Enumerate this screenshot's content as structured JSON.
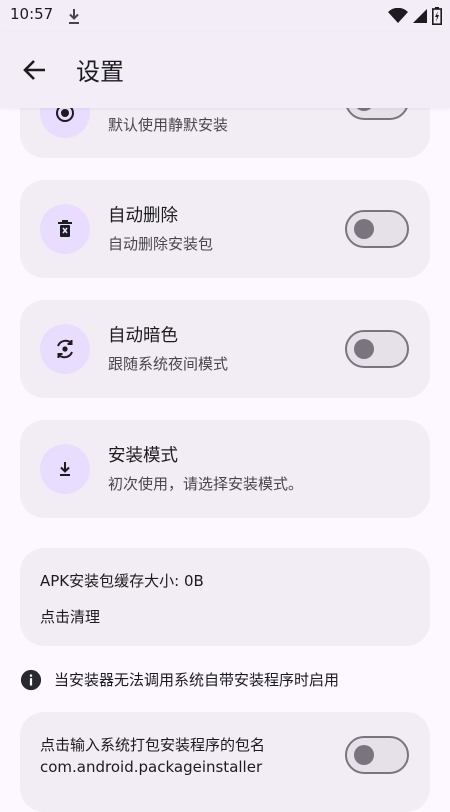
{
  "status_bar": {
    "time": "10:57",
    "download_icon": "download-icon",
    "wifi_icon": "wifi-icon",
    "signal_icon": "signal-icon",
    "battery_icon": "battery-charging-icon"
  },
  "top_bar": {
    "back_icon": "arrow-back-icon",
    "title": "设置"
  },
  "settings": {
    "silent_install": {
      "subtitle": "默认使用静默安装",
      "icon": "radio-target-icon",
      "enabled": false
    },
    "auto_delete": {
      "title": "自动删除",
      "subtitle": "自动删除安装包",
      "icon": "delete-icon",
      "enabled": false
    },
    "auto_dark": {
      "title": "自动暗色",
      "subtitle": "跟随系统夜间模式",
      "icon": "auto-dark-icon",
      "enabled": false
    },
    "install_mode": {
      "title": "安装模式",
      "subtitle": "初次使用，请选择安装模式。",
      "icon": "download-icon"
    },
    "cache": {
      "size_text": "APK安装包缓存大小: 0B",
      "clear_text": "点击清理"
    },
    "info": {
      "icon": "info-icon",
      "text": "当安装器无法调用系统自带安装程序时启用"
    },
    "package_installer": {
      "label": "点击输入系统打包安装程序的包名",
      "value": "com.android.packageinstaller",
      "enabled": false
    }
  },
  "colors": {
    "background": "#fdf7ff",
    "card": "#f2edf4",
    "icon_circle": "#e8ddff",
    "switch_outline": "#79747e",
    "text_primary": "#1c1b1f",
    "text_secondary": "#49454f"
  }
}
